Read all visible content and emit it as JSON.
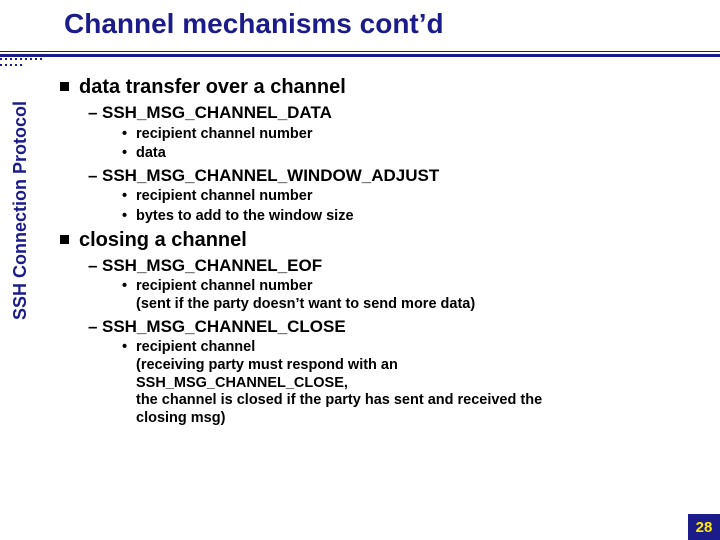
{
  "title": "Channel mechanisms cont’d",
  "sidebar_label": "SSH Connection Protocol",
  "sections": {
    "s1": {
      "heading": "data transfer over a channel",
      "items": {
        "a": {
          "label": "SSH_MSG_CHANNEL_DATA",
          "bullets": {
            "b1": "recipient channel number",
            "b2": "data"
          }
        },
        "b": {
          "label": "SSH_MSG_CHANNEL_WINDOW_ADJUST",
          "bullets": {
            "b1": "recipient channel number",
            "b2": "bytes to add to the window size"
          }
        }
      }
    },
    "s2": {
      "heading": "closing a channel",
      "items": {
        "a": {
          "label": "SSH_MSG_CHANNEL_EOF",
          "bullets": {
            "b1": "recipient channel number",
            "note1": "(sent if the party doesn’t want to send more data)"
          }
        },
        "b": {
          "label": "SSH_MSG_CHANNEL_CLOSE",
          "bullets": {
            "b1": "recipient channel",
            "note1": "(receiving party must respond with an",
            "note2": " SSH_MSG_CHANNEL_CLOSE,",
            "note3": " the channel is closed if the party has sent and received the",
            "note4": " closing msg)"
          }
        }
      }
    }
  },
  "page_number": "28"
}
